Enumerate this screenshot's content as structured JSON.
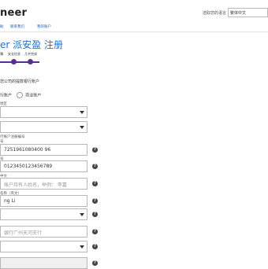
{
  "header": {
    "logo": "neer",
    "language_label": "选取您的语言",
    "language_value": "繁体中文"
  },
  "nav": [
    {
      "label": "助"
    },
    {
      "label": "联系我们"
    },
    {
      "label": "我的账户"
    }
  ],
  "page_title": "er 派安盈 注册",
  "steps": [
    {
      "label": "簿"
    },
    {
      "label": "安全信息"
    },
    {
      "label": "几乎完成"
    }
  ],
  "form": {
    "section_title": "您公司的提款银行账户",
    "radio_options": [
      {
        "label": "行账户"
      },
      {
        "label": "商业账户"
      }
    ],
    "region_label": "地区",
    "bank_type_label": "行账户注册编号",
    "field_label_prefix": "号",
    "account_number": "7251961080400 96",
    "account_number_confirm": "0123450123456789",
    "holder_cn_label": "中文",
    "holder_cn_placeholder": "账户持有人姓名，举例： 李嘉",
    "holder_en_label": "名称（英文）",
    "holder_en_value": "ng Li",
    "branch_placeholder": "银行广州天河支行",
    "help_glyph": "?"
  }
}
